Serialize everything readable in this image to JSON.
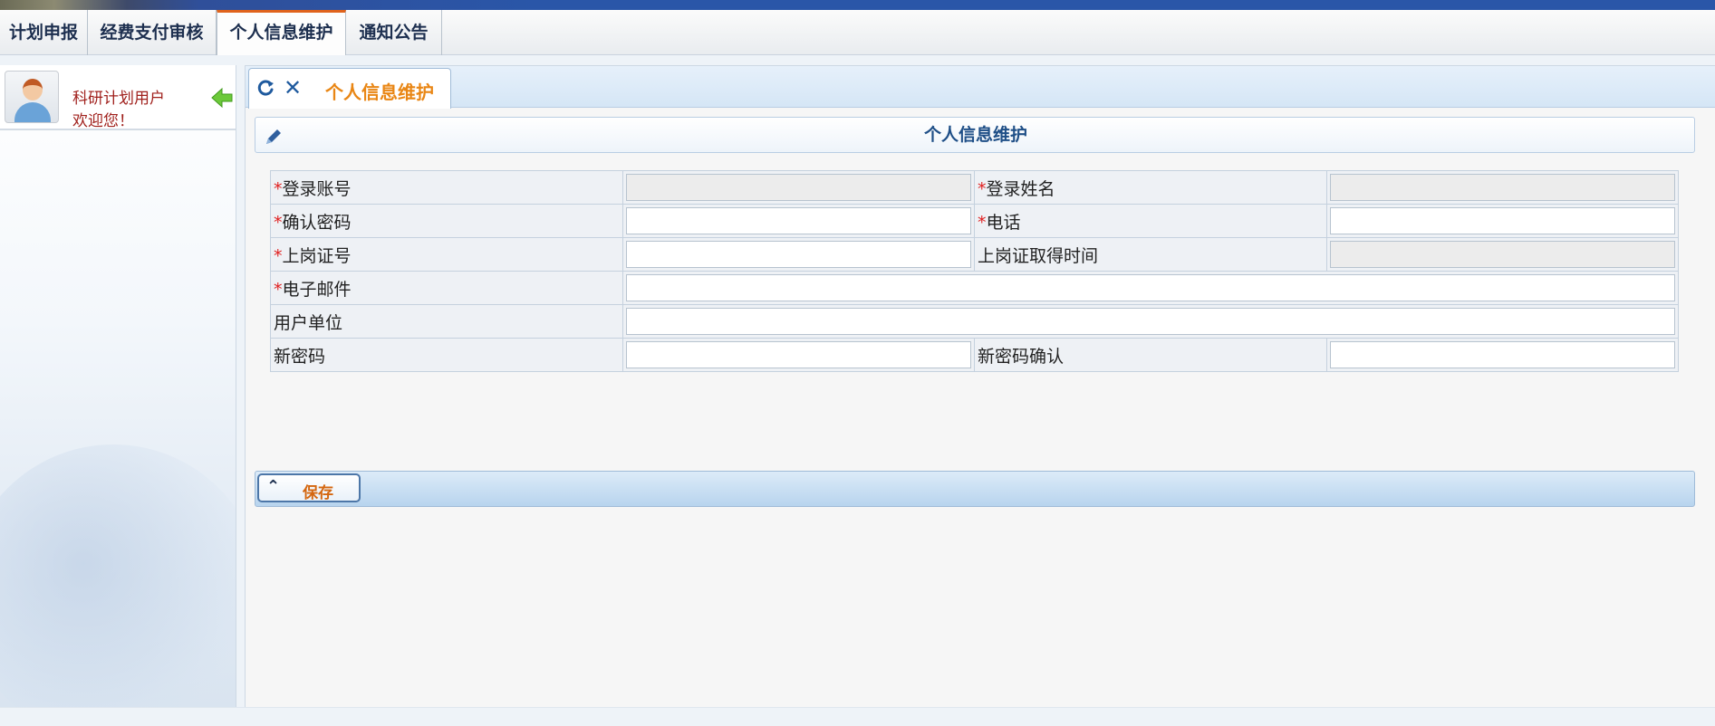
{
  "menu": {
    "items": [
      {
        "label": "计划申报"
      },
      {
        "label": "经费支付审核"
      },
      {
        "label": "个人信息维护"
      },
      {
        "label": "通知公告"
      }
    ],
    "active_index": 2
  },
  "user": {
    "name_line": "科研计划用户",
    "welcome": "欢迎您！"
  },
  "tab": {
    "title": "个人信息维护"
  },
  "panel": {
    "title": "个人信息维护"
  },
  "form": {
    "login_account_label": "登录账号",
    "login_account_value": "",
    "login_name_label": "登录姓名",
    "login_name_value": "",
    "confirm_password_label": "确认密码",
    "confirm_password_value": "",
    "phone_label": "电话",
    "phone_value": "",
    "post_cert_no_label": "上岗证号",
    "post_cert_no_value": "",
    "post_cert_time_label": "上岗证取得时间",
    "post_cert_time_value": "",
    "email_label": "电子邮件",
    "email_value": "",
    "user_unit_label": "用户单位",
    "user_unit_value": "",
    "new_password_label": "新密码",
    "new_password_value": "",
    "new_password_confirm_label": "新密码确认",
    "new_password_confirm_value": "",
    "required_mark": "*"
  },
  "actions": {
    "save_label": "保存"
  },
  "colors": {
    "required": "#e02020",
    "tab_title": "#e98614",
    "panel_title": "#1f4f87",
    "save_label": "#d4660f",
    "user_text": "#a0201c"
  },
  "icons": [
    "refresh-icon",
    "close-icon",
    "edit-icon",
    "collapse-arrow-icon",
    "caret-up-icon",
    "avatar-icon"
  ]
}
